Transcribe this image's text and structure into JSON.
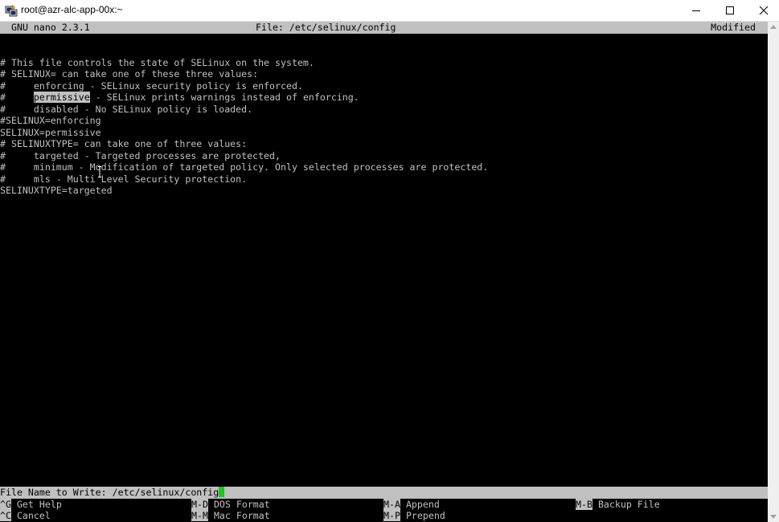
{
  "window": {
    "title": "root@azr-alc-app-00x:~"
  },
  "nano": {
    "version": "GNU nano 2.3.1",
    "file": "File: /etc/selinux/config",
    "status": "Modified"
  },
  "file_lines": [
    "",
    "",
    "# This file controls the state of SELinux on the system.",
    "# SELINUX= can take one of these three values:",
    "#     enforcing - SELinux security policy is enforced.",
    "",
    "#     disabled - No SELinux policy is loaded.",
    "#SELINUX=enforcing",
    "SELINUX=permissive",
    "# SELINUXTYPE= can take one of three values:",
    "#     targeted - Targeted processes are protected,",
    "#     minimum - Modification of targeted policy. Only selected processes are protected.",
    "#     mls - Multi Level Security protection.",
    "SELINUXTYPE=targeted"
  ],
  "highlighted_line": {
    "prefix": "#     ",
    "highlighted": "permissive",
    "suffix": " - SELinux prints warnings instead of enforcing."
  },
  "prompt": {
    "label": "File Name to Write: ",
    "value": "/etc/selinux/config"
  },
  "shortcuts": [
    {
      "key": "^G",
      "label": "Get Help"
    },
    {
      "key": "M-D",
      "label": "DOS Format"
    },
    {
      "key": "M-A",
      "label": "Append"
    },
    {
      "key": "M-B",
      "label": "Backup File"
    },
    {
      "key": "^C",
      "label": "Cancel"
    },
    {
      "key": "M-M",
      "label": "Mac Format"
    },
    {
      "key": "M-P",
      "label": "Prepend"
    }
  ],
  "colors": {
    "terminal_bg": "#000000",
    "terminal_fg": "#c0c0c0",
    "cursor": "#22c322"
  },
  "icons": {
    "app": "putty-icon",
    "minimize": "minimize-icon",
    "maximize": "maximize-icon",
    "close": "close-icon"
  }
}
